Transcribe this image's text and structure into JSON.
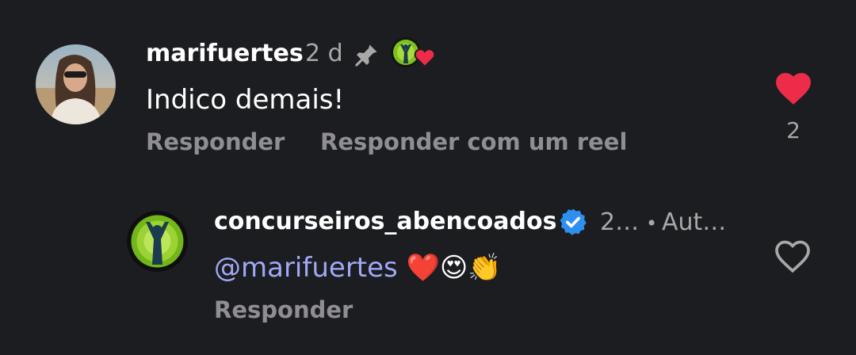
{
  "colors": {
    "background": "#1c1d21",
    "like_active": "#ed2c49",
    "mention": "#a1a8f5",
    "verified_badge": "#2f8ff0",
    "muted_text": "#a8a8a8"
  },
  "comment": {
    "username": "marifuertes",
    "time": "2 d",
    "pinned_icon": "pin-icon",
    "creator_liked_icon": "creator-liked-heart-icon",
    "text": "Indico demais!",
    "actions": {
      "reply": "Responder",
      "reply_reel": "Responder com um reel"
    },
    "likes": "2",
    "liked": true
  },
  "reply": {
    "username": "concurseiros_abencoados",
    "verified": true,
    "time": "2…",
    "separator": "•",
    "author_label": "Aut…",
    "mention": "@marifuertes",
    "emojis": "❤️😍👏",
    "actions": {
      "reply": "Responder"
    },
    "liked": false
  }
}
